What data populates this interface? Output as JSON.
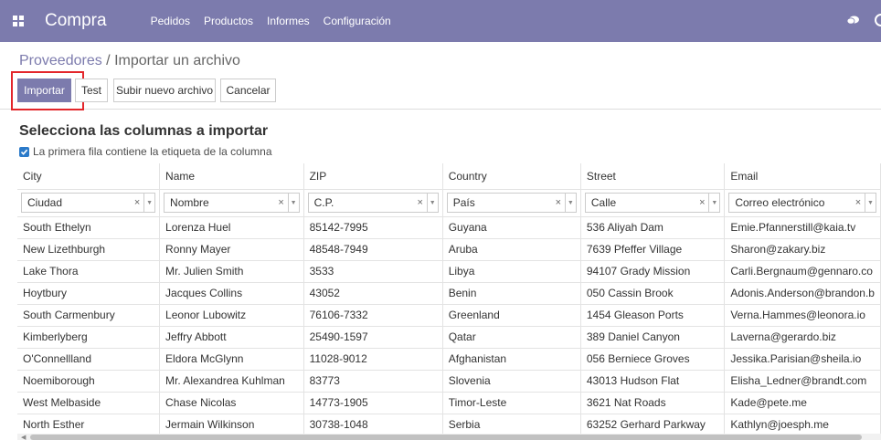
{
  "app": {
    "name": "Compra",
    "menu": [
      "Pedidos",
      "Productos",
      "Informes",
      "Configuración"
    ]
  },
  "breadcrumb": {
    "parent": "Proveedores",
    "separator": " / ",
    "current": "Importar un archivo"
  },
  "toolbar": {
    "import_label": "Importar",
    "test_label": "Test",
    "upload_label": "Subir nuevo archivo",
    "cancel_label": "Cancelar"
  },
  "content": {
    "title": "Selecciona las columnas a importar",
    "header_checkbox_label": "La primera fila contiene la etiqueta de la columna",
    "header_checkbox_checked": true
  },
  "table": {
    "columns": [
      "City",
      "Name",
      "ZIP",
      "Country",
      "Street",
      "Email"
    ],
    "mapped_fields": [
      "Ciudad",
      "Nombre",
      "C.P.",
      "País",
      "Calle",
      "Correo electrónico"
    ],
    "rows": [
      [
        "South Ethelyn",
        "Lorenza Huel",
        "85142-7995",
        "Guyana",
        "536 Aliyah Dam",
        "Emie.Pfannerstill@kaia.tv"
      ],
      [
        "New Lizethburgh",
        "Ronny Mayer",
        "48548-7949",
        "Aruba",
        "7639 Pfeffer Village",
        "Sharon@zakary.biz"
      ],
      [
        "Lake Thora",
        "Mr. Julien Smith",
        "3533",
        "Libya",
        "94107 Grady Mission",
        "Carli.Bergnaum@gennaro.co"
      ],
      [
        "Hoytbury",
        "Jacques Collins",
        "43052",
        "Benin",
        "050 Cassin Brook",
        "Adonis.Anderson@brandon.b"
      ],
      [
        "South Carmenbury",
        "Leonor Lubowitz",
        "76106-7332",
        "Greenland",
        "1454 Gleason Ports",
        "Verna.Hammes@leonora.io"
      ],
      [
        "Kimberlyberg",
        "Jeffry Abbott",
        "25490-1597",
        "Qatar",
        "389 Daniel Canyon",
        "Laverna@gerardo.biz"
      ],
      [
        "O'Connellland",
        "Eldora McGlynn",
        "11028-9012",
        "Afghanistan",
        "056 Berniece Groves",
        "Jessika.Parisian@sheila.io"
      ],
      [
        "Noemiborough",
        "Mr. Alexandrea Kuhlman",
        "83773",
        "Slovenia",
        "43013 Hudson Flat",
        "Elisha_Ledner@brandt.com"
      ],
      [
        "West Melbaside",
        "Chase Nicolas",
        "14773-1905",
        "Timor-Leste",
        "3621 Nat Roads",
        "Kade@pete.me"
      ],
      [
        "North Esther",
        "Jermain Wilkinson",
        "30738-1048",
        "Serbia",
        "63252 Gerhard Parkway",
        "Kathlyn@joesph.me"
      ]
    ]
  },
  "icons": {
    "apps": "apps-grid-icon",
    "chat": "chat-bubble-icon",
    "clock": "clock-icon",
    "clear": "×",
    "dropdown": "▼",
    "scroll_left": "◀"
  },
  "colors": {
    "brand": "#7c7bad",
    "highlight": "#e3262b",
    "checkbox": "#2b7ac9"
  }
}
